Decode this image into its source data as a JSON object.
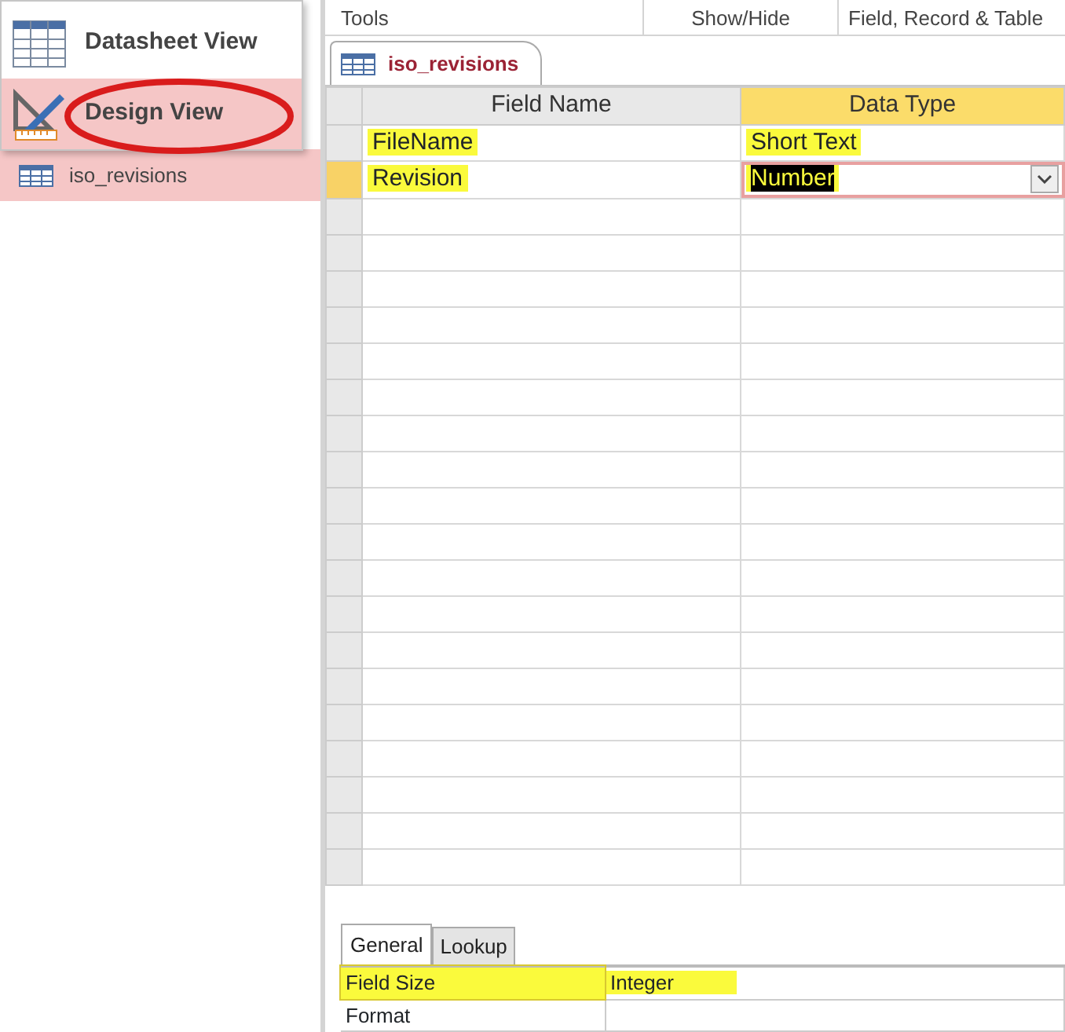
{
  "ribbon_groups": [
    {
      "label": "Tools"
    },
    {
      "label": "Show/Hide"
    },
    {
      "label": "Field, Record & Table"
    }
  ],
  "view_menu": {
    "items": [
      {
        "label": "Datasheet View",
        "kind": "datasheet",
        "selected": false,
        "circled": false
      },
      {
        "label": "Design View",
        "kind": "design",
        "selected": true,
        "circled": true
      }
    ]
  },
  "navigation_pane": {
    "items": [
      {
        "label": "iso_revisions",
        "selected": true
      }
    ]
  },
  "document_tab": {
    "label": "iso_revisions",
    "selected": true
  },
  "table_design": {
    "columns": [
      {
        "label": "Field Name",
        "selected": false
      },
      {
        "label": "Data Type",
        "selected": true
      }
    ],
    "rows": [
      {
        "current": false,
        "cells": [
          {
            "text": "FileName",
            "highlighted": true,
            "selected": false
          },
          {
            "text": "Short Text",
            "highlighted": true,
            "selected": false
          }
        ]
      },
      {
        "current": true,
        "cells": [
          {
            "text": "Revision",
            "highlighted": true,
            "selected": false
          },
          {
            "text": "Number",
            "highlighted": true,
            "selected": true
          }
        ]
      }
    ]
  },
  "field_properties": {
    "tabs": [
      {
        "label": "General",
        "selected": true
      },
      {
        "label": "Lookup",
        "selected": false
      }
    ],
    "rows": [
      {
        "label": "Field Size",
        "value": "Integer",
        "highlighted": true
      },
      {
        "label": "Format",
        "value": "",
        "highlighted": false
      }
    ]
  }
}
